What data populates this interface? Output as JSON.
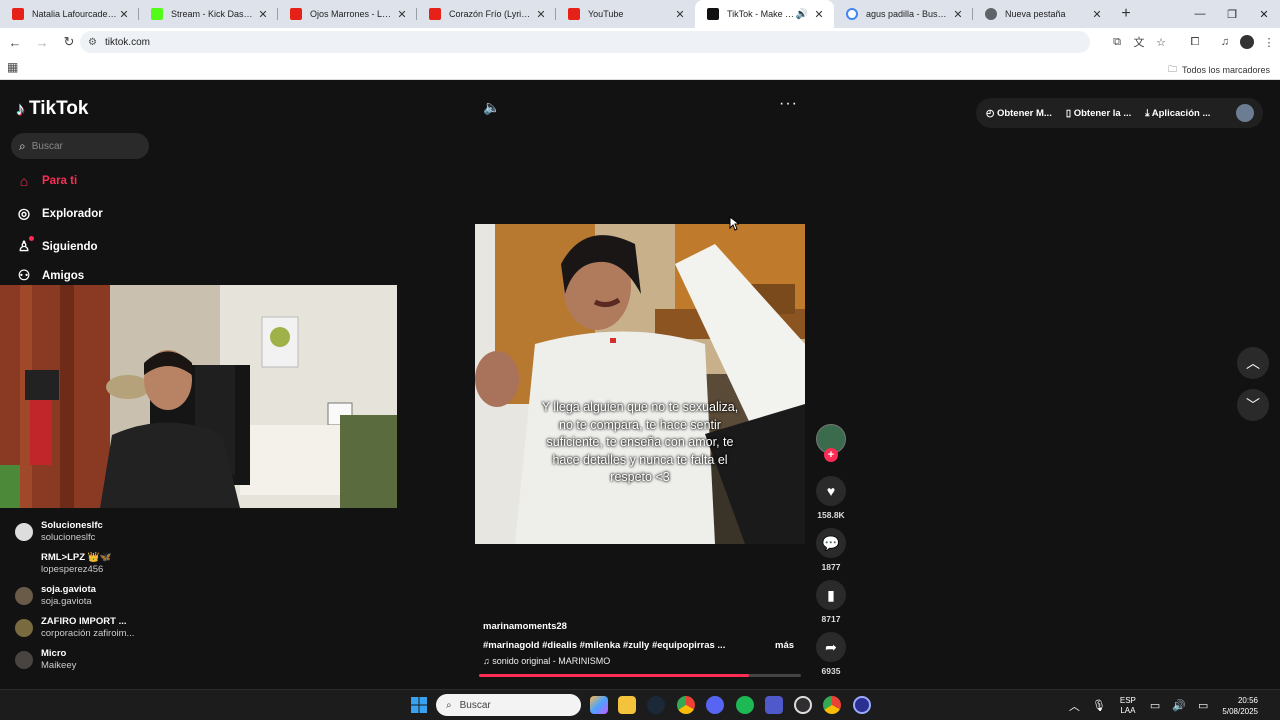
{
  "browser": {
    "tabs": [
      {
        "title": "Natalia Lafourcade - Hasta",
        "color": "#e62117",
        "active": false
      },
      {
        "title": "Stream - Kick Dashboard",
        "color": "#53fc18",
        "active": false
      },
      {
        "title": "Ojos Marrones - Lasso (Ly",
        "color": "#e62117",
        "active": false
      },
      {
        "title": "Corazón Frío (Lyric Video)",
        "color": "#e62117",
        "active": false
      },
      {
        "title": "YouTube",
        "color": "#e62117",
        "active": false
      },
      {
        "title": "TikTok - Make Your Day",
        "color": "#111111",
        "active": true
      },
      {
        "title": "agus padilla - Buscar con",
        "color": "#4285f4",
        "active": false
      },
      {
        "title": "Nueva pestaña",
        "color": "#5f6368",
        "active": false
      }
    ],
    "url": "tiktok.com",
    "bookmarks_all": "Todos los marcadores"
  },
  "sidebar": {
    "logo_text": "TikTok",
    "search_placeholder": "Buscar",
    "nav": [
      {
        "label": "Para ti",
        "icon": "home-icon",
        "active": true
      },
      {
        "label": "Explorador",
        "icon": "compass-icon",
        "active": false
      },
      {
        "label": "Siguiendo",
        "icon": "following-icon",
        "active": false
      },
      {
        "label": "Amigos",
        "icon": "friends-icon",
        "active": false
      }
    ],
    "following": [
      {
        "name": "Solucioneslfc",
        "handle": "solucioneslfc"
      },
      {
        "name": "RML>LPZ 👑🦋",
        "handle": "lopesperez456"
      },
      {
        "name": "soja.gaviota",
        "handle": "soja.gaviota"
      },
      {
        "name": "ZAFIRO IMPORT ...",
        "handle": "corporación zafiroim..."
      },
      {
        "name": "Micro",
        "handle": "Maikeey"
      }
    ]
  },
  "topbar": {
    "coins": "Obtener M...",
    "app": "Obtener la ...",
    "download": "Aplicación ..."
  },
  "video": {
    "caption": "Y llega alguien que no te sexualiza, no te compara, te hace sentir suficiente, te enseña con amor, te hace detalles y nunca te falta el respeto <3",
    "author": "marinamoments28",
    "tags": "#marinagold #diealis #milenka #zully #equipopirras ...",
    "more": "más",
    "sound": "sonido original - MARINISMO",
    "likes": "158.8K",
    "comments": "1877",
    "saves": "8717",
    "shares": "6935",
    "progress": 0.84
  },
  "taskbar": {
    "search_placeholder": "Buscar",
    "lang_top": "ESP",
    "lang_bottom": "LAA",
    "time": "20:56",
    "date": "5/08/2025"
  }
}
